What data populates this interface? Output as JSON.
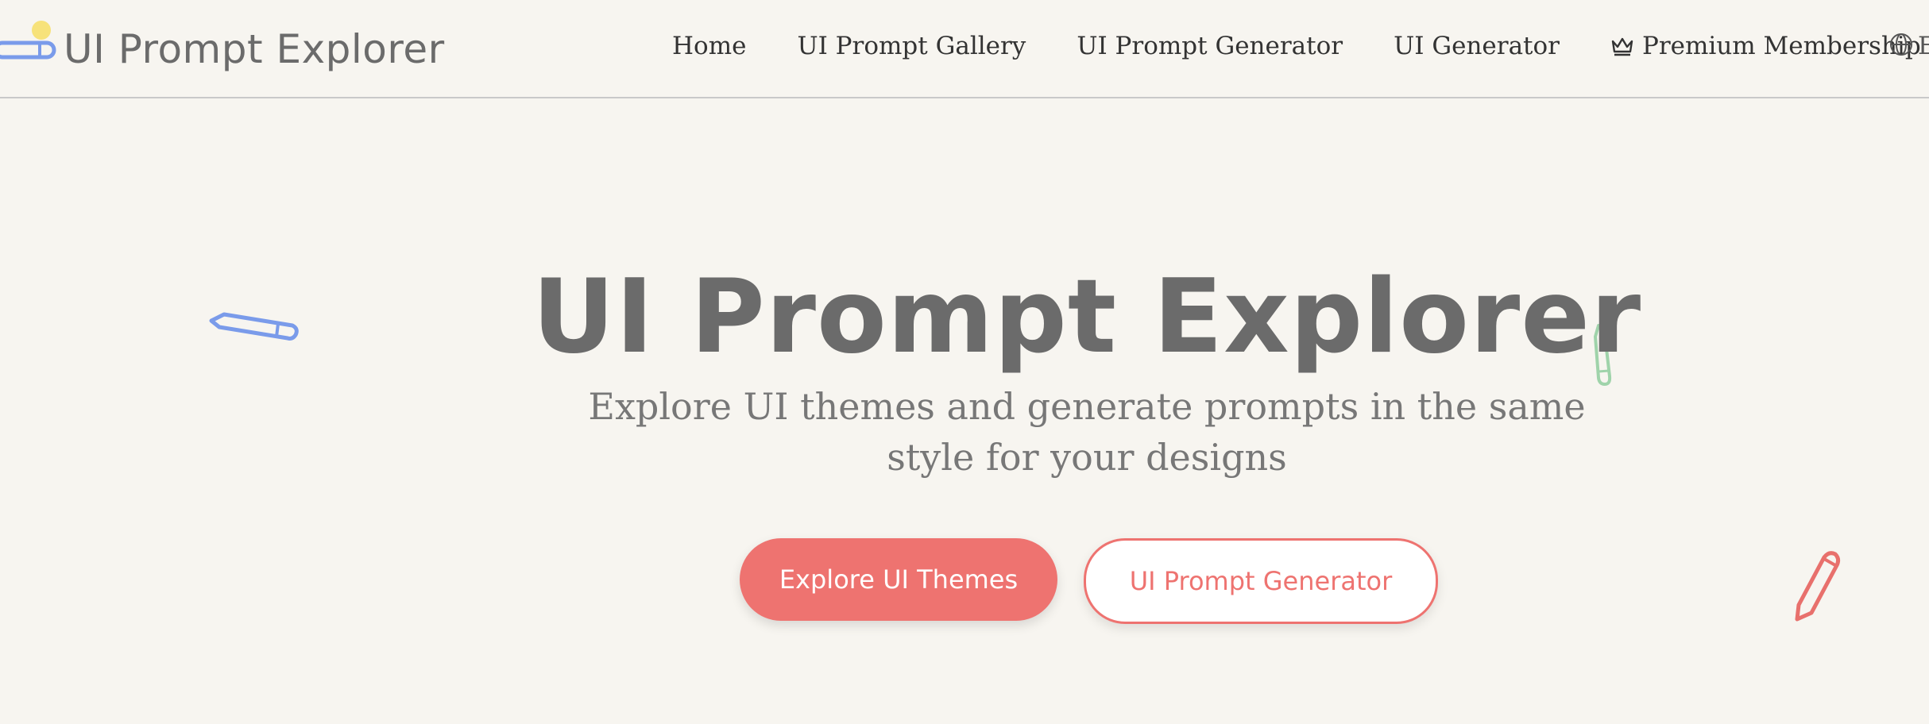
{
  "brand": {
    "title": "UI Prompt Explorer",
    "icon": "pencil-logo-icon"
  },
  "nav": {
    "items": [
      {
        "label": "Home"
      },
      {
        "label": "UI Prompt Gallery"
      },
      {
        "label": "UI Prompt Generator"
      },
      {
        "label": "UI Generator"
      },
      {
        "label": "Premium Membership",
        "icon": "crown-icon"
      }
    ],
    "language": {
      "icon": "globe-icon",
      "label": "E"
    }
  },
  "hero": {
    "title": "UI Prompt Explorer",
    "subtitle": "Explore UI themes and generate prompts in the same style for your designs",
    "primary_button": "Explore UI Themes",
    "secondary_button": "UI Prompt Generator"
  },
  "colors": {
    "background": "#f7f5f0",
    "accent": "#ee7370",
    "blue_pencil": "#7a9bea",
    "green_pencil": "#9fd3aa",
    "red_pencil": "#e8706c",
    "yellow_dot": "#f7e27a"
  }
}
